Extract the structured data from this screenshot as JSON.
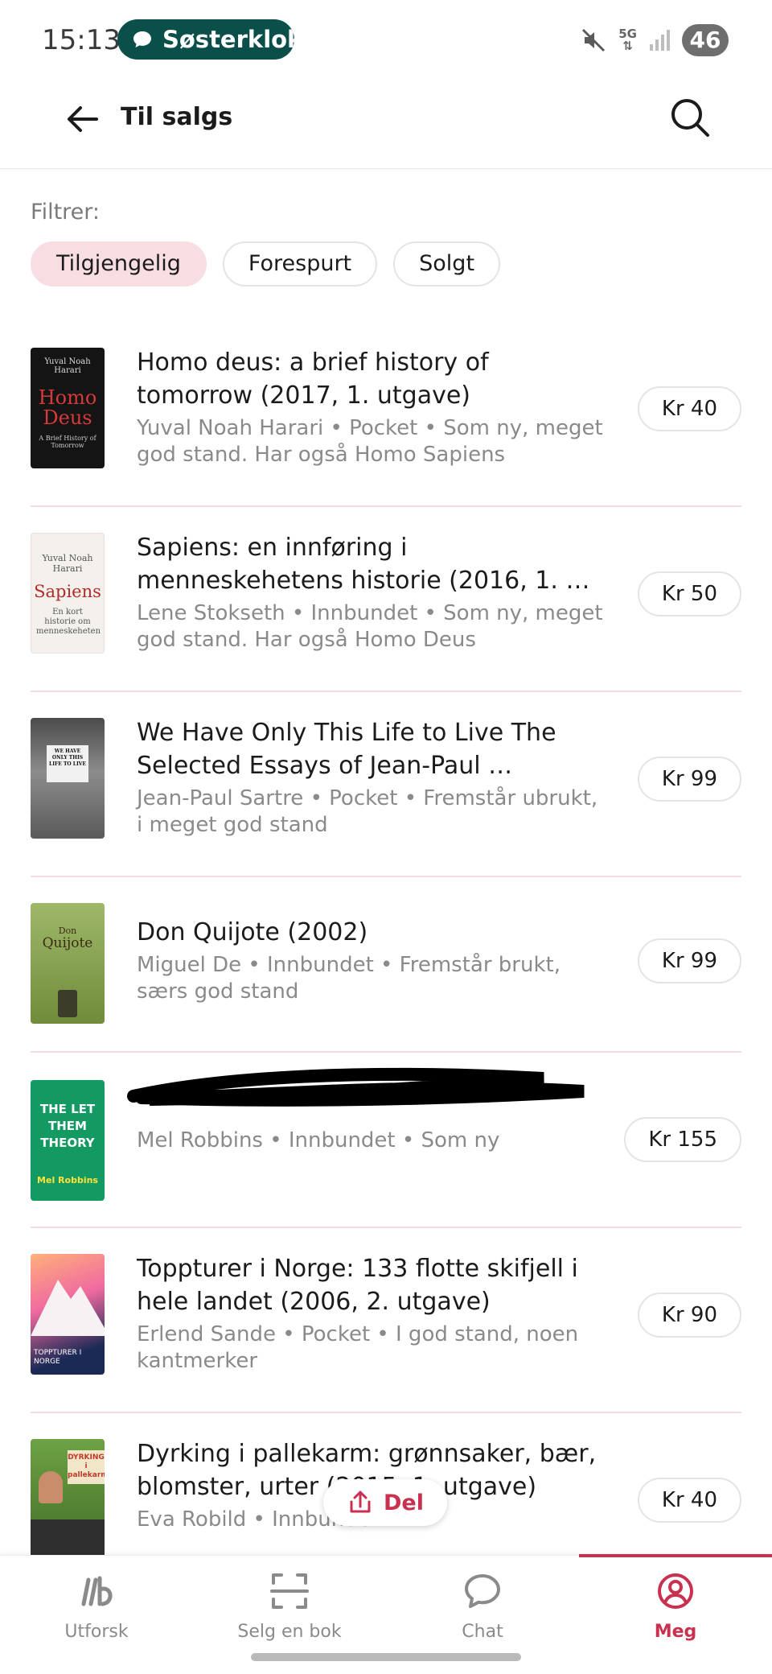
{
  "status_bar": {
    "time": "15:13",
    "notification": "Søsterklokke",
    "network": "5G",
    "battery": "46"
  },
  "header": {
    "title": "Til salgs"
  },
  "filters": {
    "label": "Filtrer:",
    "chips": [
      "Tilgjengelig",
      "Forespurt",
      "Solgt"
    ],
    "active": "Tilgjengelig"
  },
  "books": [
    {
      "title": "Homo deus: a brief history of tomorrow (2017, 1. utgave)",
      "meta": "Yuval Noah Harari • Pocket • Som ny, meget god stand. Har også Homo Sapiens",
      "price": "Kr 40",
      "cover": {
        "author": "Yuval Noah Harari",
        "title": "Homo Deus",
        "subtitle": "A Brief History of Tomorrow"
      }
    },
    {
      "title": "Sapiens: en innføring i menneskehetens historie (2016, 1. …",
      "meta": "Lene Stokseth • Innbundet • Som ny, meget god stand. Har også Homo Deus",
      "price": "Kr 50",
      "cover": {
        "author": "Yuval Noah Harari",
        "title": "Sapiens",
        "subtitle": "En kort historie om menneskeheten"
      }
    },
    {
      "title": "We Have Only This Life to Live The Selected Essays of Jean-Paul …",
      "meta": "Jean-Paul Sartre • Pocket • Fremstår ubrukt, i meget god stand",
      "price": "Kr 99",
      "cover": {
        "title": "WE HAVE ONLY THIS LIFE TO LIVE"
      }
    },
    {
      "title": "Don Quijote (2002)",
      "meta": "Miguel De • Innbundet • Fremstår brukt, særs god stand",
      "price": "Kr 99",
      "cover": {
        "author": "Don",
        "title": "Quijote"
      }
    },
    {
      "title": "",
      "meta": "Mel Robbins • Innbundet • Som ny",
      "price": "Kr 155",
      "cover": {
        "title": "THE LET THEM THEORY",
        "author": "Mel Robbins"
      }
    },
    {
      "title": "Toppturer i Norge: 133 flotte skifjell i hele landet (2006, 2. utgave)",
      "meta": "Erlend Sande • Pocket • I god stand, noen kantmerker",
      "price": "Kr 90",
      "cover": {
        "title": "TOPPTURER I NORGE"
      }
    },
    {
      "title": "Dyrking i pallekarm: grønnsaker, bær, blomster, urter (2015, 1. utgave)",
      "meta": "Eva Robild • Innbundet",
      "price": "Kr 40",
      "cover": {
        "title": "DYRKING i pallekarm"
      }
    }
  ],
  "share_button": {
    "label": "Del"
  },
  "bottom_nav": {
    "items": [
      {
        "label": "Utforsk",
        "icon": "library-icon"
      },
      {
        "label": "Selg en bok",
        "icon": "scan-icon"
      },
      {
        "label": "Chat",
        "icon": "chat-icon"
      },
      {
        "label": "Meg",
        "icon": "profile-icon"
      }
    ],
    "active": "Meg"
  },
  "colors": {
    "accent": "#c8314f",
    "chip_active_bg": "#f8dde3",
    "notification_pill": "#0b4f4b",
    "text_secondary": "#8a8a8a"
  }
}
